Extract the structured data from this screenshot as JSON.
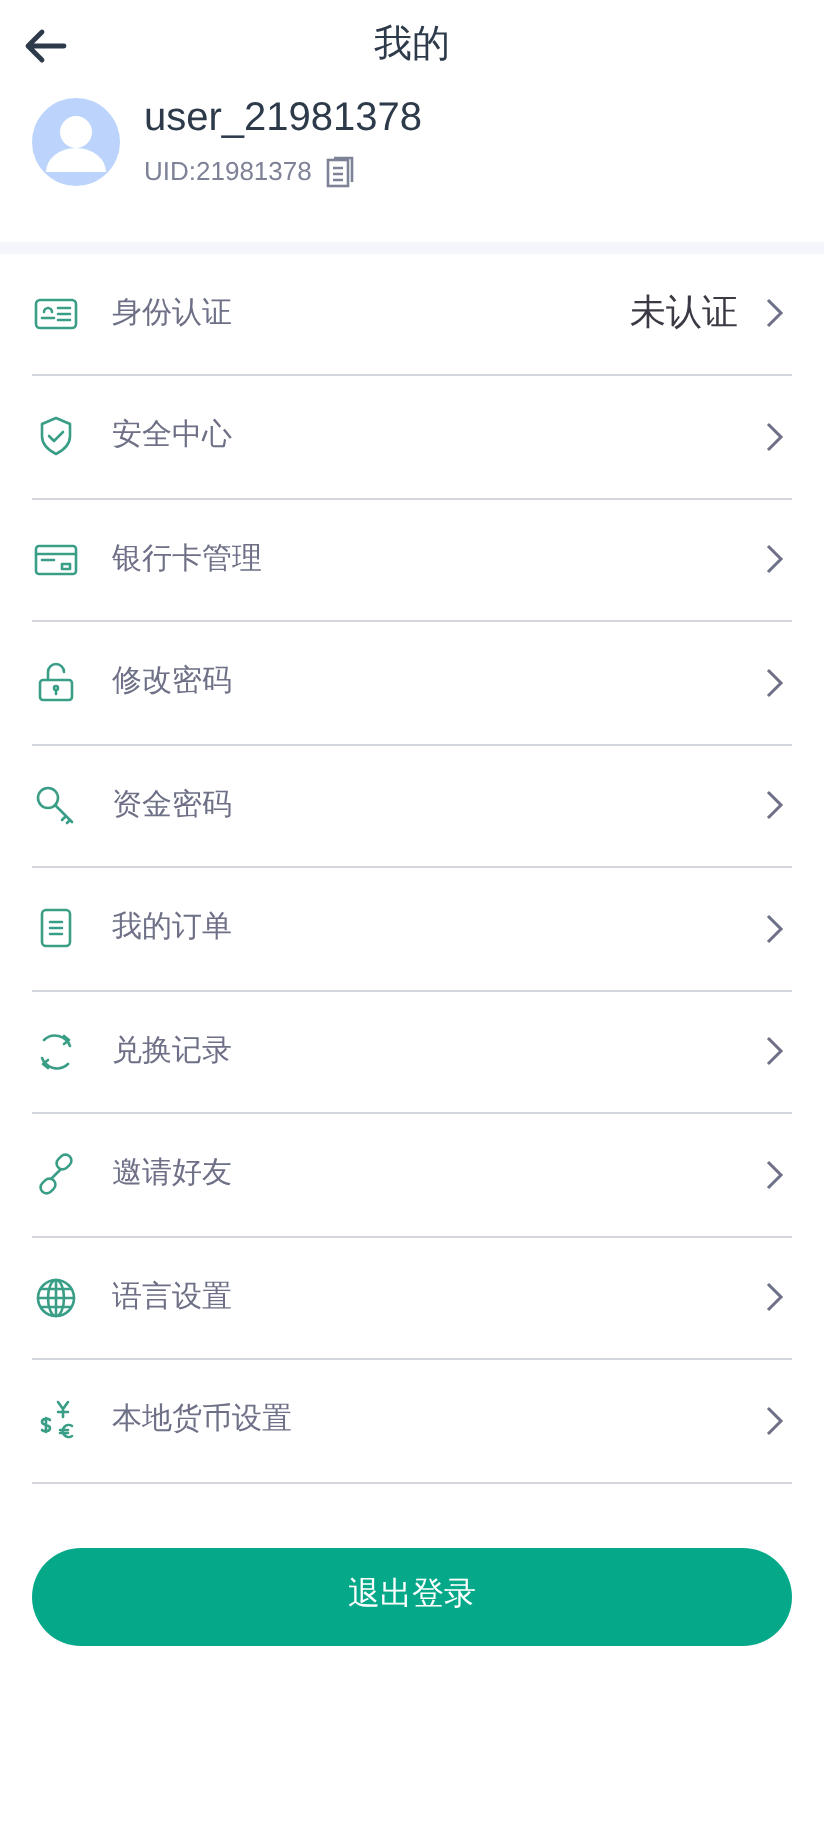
{
  "header": {
    "title": "我的"
  },
  "profile": {
    "username": "user_21981378",
    "uid": "UID:21981378"
  },
  "menu": [
    {
      "label": "身份认证",
      "value": "未认证"
    },
    {
      "label": "安全中心"
    },
    {
      "label": "银行卡管理"
    },
    {
      "label": "修改密码"
    },
    {
      "label": "资金密码"
    },
    {
      "label": "我的订单"
    },
    {
      "label": "兑换记录"
    },
    {
      "label": "邀请好友"
    },
    {
      "label": "语言设置"
    },
    {
      "label": "本地货币设置"
    }
  ],
  "logout_button": "退出登录"
}
